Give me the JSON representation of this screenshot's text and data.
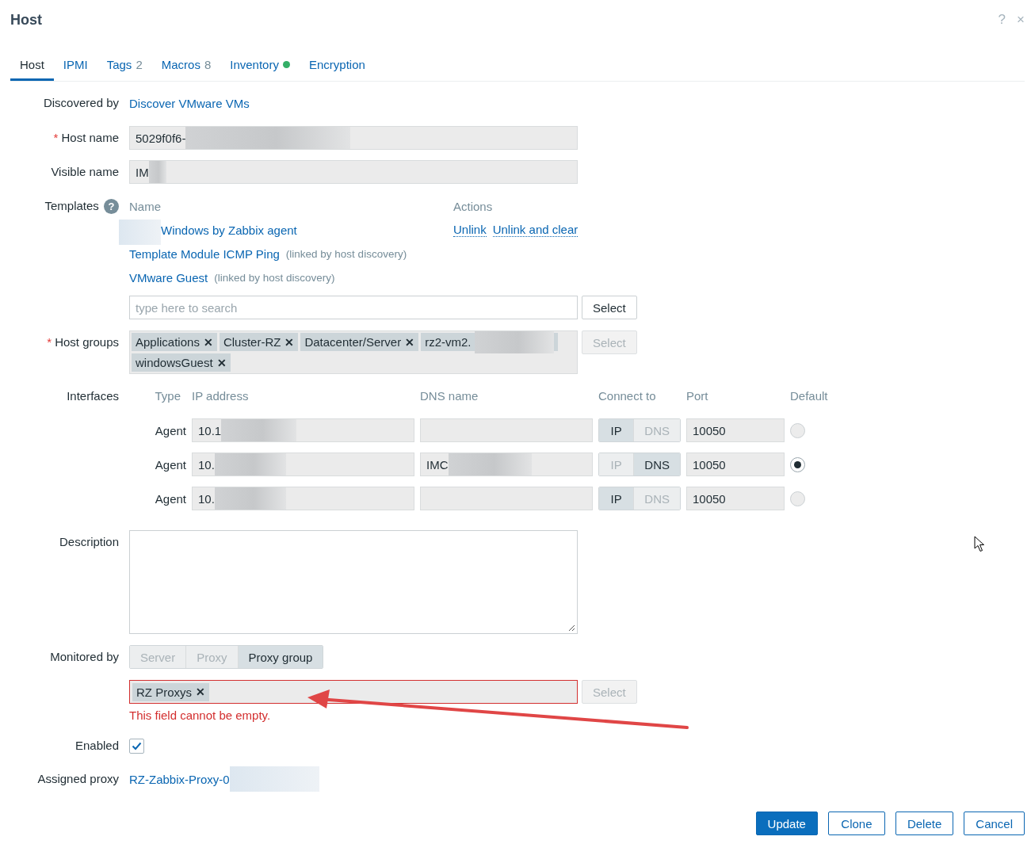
{
  "dialog": {
    "title": "Host",
    "help": "?",
    "close": "×"
  },
  "tabs": [
    {
      "label": "Host",
      "selected": true
    },
    {
      "label": "IPMI",
      "selected": false
    },
    {
      "label": "Tags",
      "count": "2",
      "selected": false
    },
    {
      "label": "Macros",
      "count": "8",
      "selected": false
    },
    {
      "label": "Inventory",
      "indicator": true,
      "selected": false
    },
    {
      "label": "Encryption",
      "selected": false
    }
  ],
  "discovered_by": {
    "label": "Discovered by",
    "link": "Discover VMware VMs"
  },
  "host_name": {
    "label": "Host name",
    "required_mark": "*",
    "value": "5029f0f6-",
    "redacted": true
  },
  "visible_name": {
    "label": "Visible name",
    "value": "IM",
    "redacted": true
  },
  "templates": {
    "label": "Templates",
    "help": "?",
    "columns": [
      "Name",
      "Actions"
    ],
    "items": [
      {
        "name": "Windows by Zabbix agent",
        "redacted": true,
        "actions": [
          "Unlink",
          "Unlink and clear"
        ]
      },
      {
        "name": "Template Module ICMP Ping",
        "note": "(linked by host discovery)",
        "redacted": false
      },
      {
        "name": "VMware Guest",
        "note": "(linked by host discovery)",
        "redacted": false
      }
    ],
    "search": {
      "placeholder": "type here to search"
    },
    "select": {
      "label": "Select",
      "disabled": false
    }
  },
  "host_groups": {
    "label": "Host groups",
    "required_mark": "*",
    "tags": [
      {
        "label": "Applications",
        "redacted": false
      },
      {
        "label": "Cluster-RZ",
        "redacted": false
      },
      {
        "label": "Datacenter/Server",
        "redacted": false
      },
      {
        "label": "rz2-vm2.",
        "redacted": true
      },
      {
        "label": "windowsGuest",
        "redacted": false
      }
    ],
    "remove": "✕",
    "select": {
      "label": "Select",
      "disabled": true
    }
  },
  "interfaces": {
    "label": "Interfaces",
    "columns": [
      "Type",
      "IP address",
      "DNS name",
      "Connect to",
      "Port",
      "Default"
    ],
    "rows": [
      {
        "type": "Agent",
        "ip": "10.1",
        "ip_redacted": true,
        "dns_redacted": false,
        "connect": [
          {
            "label": "IP",
            "selected": true
          },
          {
            "label": "DNS",
            "selected": false
          }
        ],
        "port": "10050",
        "default": false
      },
      {
        "type": "Agent",
        "ip": "10.",
        "ip_redacted": true,
        "dns": "IMC",
        "dns_redacted": true,
        "connect": [
          {
            "label": "IP",
            "selected": false
          },
          {
            "label": "DNS",
            "selected": true
          }
        ],
        "port": "10050",
        "default": true
      },
      {
        "type": "Agent",
        "ip": "10.",
        "ip_redacted": true,
        "dns_redacted": false,
        "connect": [
          {
            "label": "IP",
            "selected": true
          },
          {
            "label": "DNS",
            "selected": false
          }
        ],
        "port": "10050",
        "default": false
      }
    ]
  },
  "description": {
    "label": "Description"
  },
  "monitored_by": {
    "label": "Monitored by",
    "options": [
      {
        "label": "Server",
        "selected": false
      },
      {
        "label": "Proxy",
        "selected": false
      },
      {
        "label": "Proxy group",
        "selected": true
      }
    ],
    "proxy_group": {
      "tag": "RZ Proxys",
      "remove": "✕",
      "error": true,
      "select": {
        "label": "Select",
        "disabled": true
      }
    },
    "error_message": "This field cannot be empty."
  },
  "enabled": {
    "label": "Enabled",
    "checked": true
  },
  "assigned_proxy": {
    "label": "Assigned proxy",
    "link": "RZ-Zabbix-Proxy-0",
    "redacted": true
  },
  "buttons": [
    {
      "label": "Update",
      "primary": true
    },
    {
      "label": "Clone",
      "primary": false
    },
    {
      "label": "Delete",
      "primary": false
    },
    {
      "label": "Cancel",
      "primary": false
    }
  ]
}
